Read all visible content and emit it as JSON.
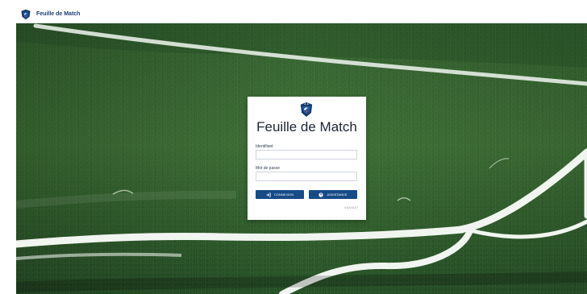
{
  "app": {
    "title": "Feuille de Match",
    "logo_icon": "fff-shield-logo"
  },
  "login": {
    "title": "Feuille de Match",
    "username_label": "Identifiant",
    "username_value": "",
    "password_label": "Mot de passe",
    "password_value": "",
    "login_button": "CONNEXION",
    "help_button": "ASSISTANCE",
    "version": "v 4.0.0.17"
  },
  "icons": {
    "login": "sign-in-icon",
    "help": "question-circle-icon"
  },
  "colors": {
    "brand": "#164c86",
    "brand_text": "#1a3e78",
    "pitch_grass": "#2f5f2a"
  }
}
